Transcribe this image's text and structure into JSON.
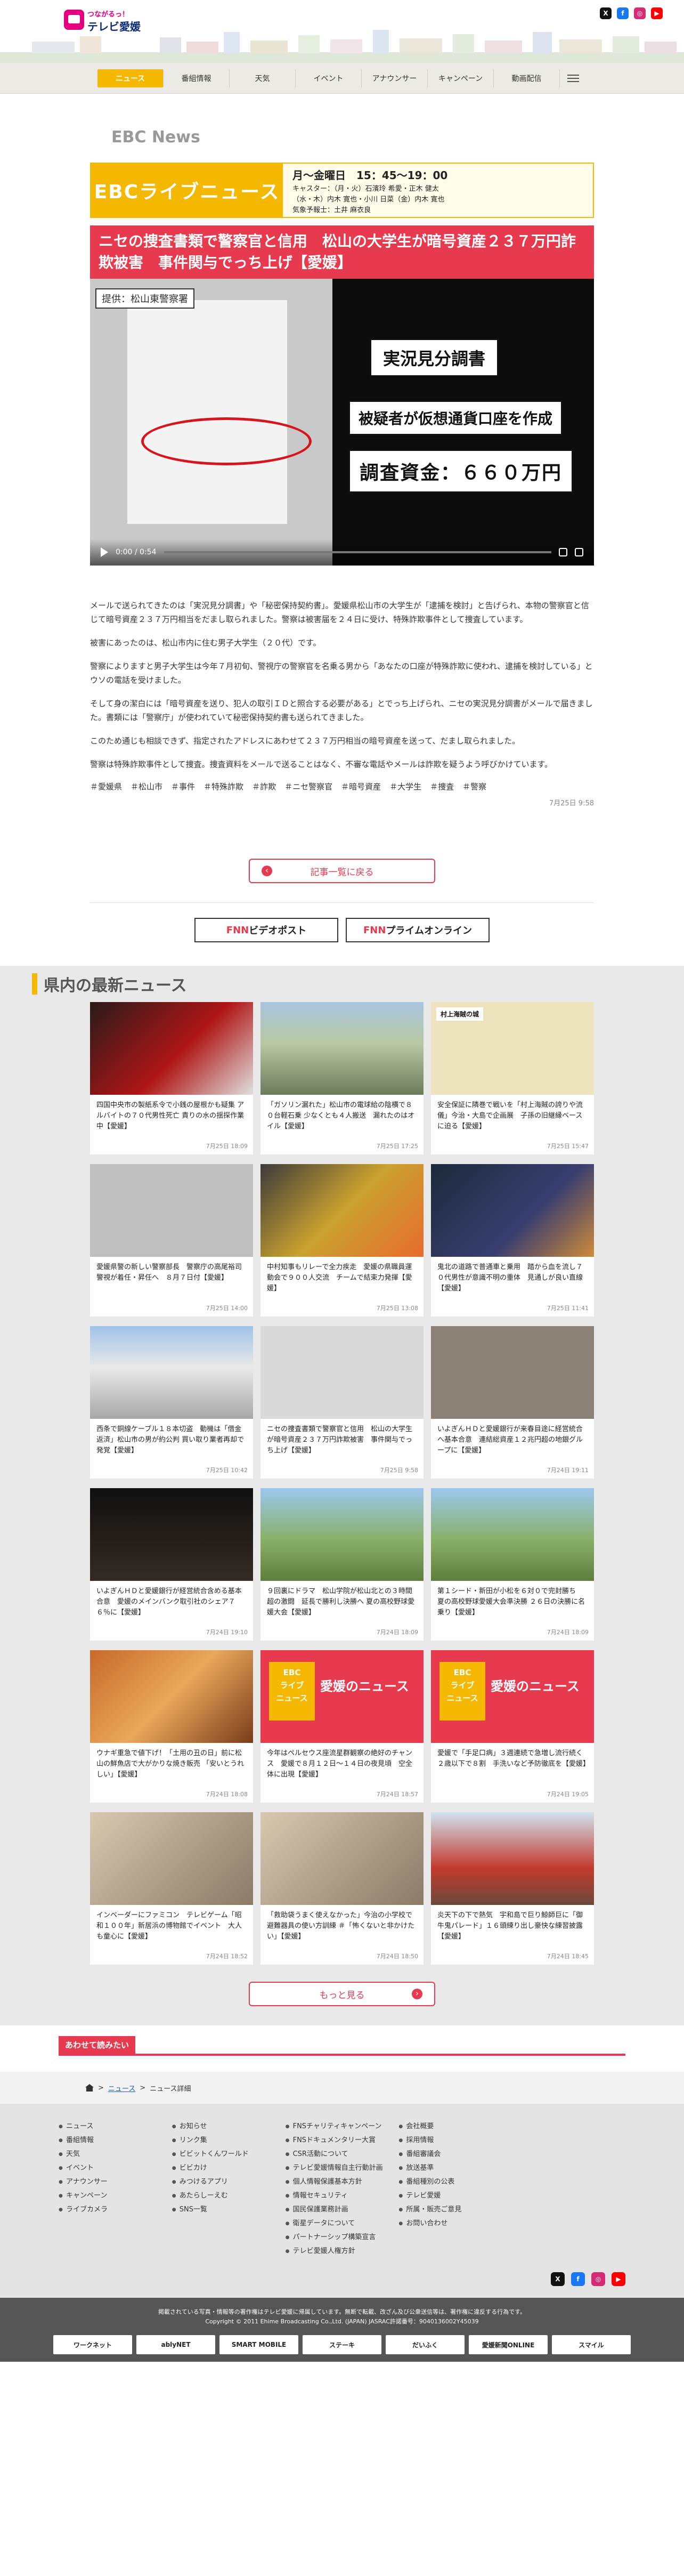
{
  "header": {
    "logo_top": "つながるっ！",
    "logo_main": "テレビ愛媛",
    "social": [
      {
        "name": "x-icon",
        "glyph": "X",
        "color": "#111111"
      },
      {
        "name": "facebook-icon",
        "glyph": "f",
        "color": "#1877f2"
      },
      {
        "name": "instagram-icon",
        "glyph": "◎",
        "color": "#d62976"
      },
      {
        "name": "youtube-icon",
        "glyph": "▶",
        "color": "#ff0000"
      }
    ]
  },
  "nav": {
    "items": [
      "ニュース",
      "番組情報",
      "天気",
      "イベント",
      "アナウンサー",
      "キャンペーン",
      "動画配信"
    ]
  },
  "section_title": "EBC News",
  "banner": {
    "title": "EBCライブニュース",
    "time": "月～金曜日　15：45～19：00",
    "cast1": "キャスター：（月・火）石濱玲 希愛・正木 健太",
    "cast2": "（水・木）内木 寛也・小川 日菜（金）内木 寛也",
    "cast3": "気象予報士：土井 麻衣良"
  },
  "article": {
    "headline": "ニセの捜査書類で警察官と信用　松山の大学生が暗号資産２３７万円詐欺被害　事件関与でっち上げ【愛媛】",
    "video": {
      "doc_tag": "提供：松山東警察署",
      "cap1": "実況見分調書",
      "cap2": "被疑者が仮想通貨口座を作成",
      "cap3": "調査資金：６６０万円",
      "time": "0:00 / 0:54"
    },
    "paragraphs": [
      "メールで送られてきたのは「実況見分調書」や「秘密保持契約書」。愛媛県松山市の大学生が「逮捕を検討」と告げられ、本物の警察官と信じて暗号資産２３７万円相当をだまし取られました。警察は被害届を２４日に受け、特殊詐欺事件として捜査しています。",
      "被害にあったのは、松山市内に住む男子大学生（２０代）です。",
      "警察によりますと男子大学生は今年７月初旬、警視庁の警察官を名乗る男から「あなたの口座が特殊詐欺に使われ、逮捕を検討している」とウソの電話を受けました。",
      "そして身の潔白には「暗号資産を送り、犯人の取引ＩＤと照合する必要がある」とでっち上げられ、ニセの実況見分調書がメールで届きました。書類には「警察庁」が使われていて秘密保持契約書も送られてきました。",
      "このため通じも相談できず、指定されたアドレスにあわせて２３７万円相当の暗号資産を送って、だまし取られました。",
      "警察は特殊詐欺事件として捜査。捜査資料をメールで送ることはなく、不審な電話やメールは詐欺を疑うよう呼びかけています。"
    ],
    "tags": [
      "＃愛媛県",
      "＃松山市",
      "＃事件",
      "＃特殊詐欺",
      "＃詐欺",
      "＃ニセ警察官",
      "＃暗号資産",
      "＃大学生",
      "＃捜査",
      "＃警察"
    ],
    "date": "7月25日 9:58"
  },
  "back_label": "記事一覧に戻る",
  "partners": [
    {
      "a": "FNN",
      "b": "ビデオポスト"
    },
    {
      "a": "FNN",
      "b": "プライムオンライン"
    }
  ],
  "news_heading": "県内の最新ニュース",
  "news": [
    {
      "thumb": "t-red",
      "title": "四国中央市の製紙系令で小銭の屋根かも疑集 アルバイトの７０代男性死亡 責りの水の揺探作業中【愛媛】",
      "date": "7月25日 18:09"
    },
    {
      "thumb": "t-town",
      "title": "「ガソリン漏れた」松山市の電球給の陰横で８０台軽石乗 少なくとも４人搬送　漏れたのはオイル【愛媛】",
      "date": "7月25日 17:25"
    },
    {
      "thumb": "t-doc",
      "overlay": "村上海賊の城",
      "title": "安全保証に隣巻で戦いを「村上海賊の誇りや流儀」今治・大島で企画展　子孫の旧継縁ベースに迫る【愛媛】",
      "date": "7月25日 15:47"
    },
    {
      "thumb": "t-man",
      "title": "愛媛県警の新しい警察部長　警察庁の高尾裕司警視が着任・昇任へ　８月７日付【愛媛】",
      "date": "7月25日 14:00"
    },
    {
      "thumb": "t-crowd",
      "title": "中村知事もリレーで全力疾走　愛媛の県職員運動会で９００人交流　チームで結束力発揮【愛媛】",
      "date": "7月25日 13:08"
    },
    {
      "thumb": "t-dark",
      "title": "鬼北の道路で普通車と乗用　踏から血を流し７０代男性が意識不明の重体　見通しが良い直線【愛媛】",
      "date": "7月25日 11:41"
    },
    {
      "thumb": "t-school",
      "title": "西条で銅線ケーブル１８本切盗　動機は「借金返済」松山市の男が約公判 買い取り業者再却で発覚【愛媛】",
      "date": "7月25日 10:42"
    },
    {
      "thumb": "t-paper",
      "title": "ニセの捜査書類で警察官と信用　松山の大学生が暗号資産２３７万円詐欺被害　事件関与でっち上げ【愛媛】",
      "date": "7月25日 9:58"
    },
    {
      "thumb": "t-sign",
      "title": "いよぎんＨＤと愛媛銀行が来春目途に経営統合へ基本合意　連結総資産１２兆円超の地銀グループに【愛媛】",
      "date": "7月24日 19:11"
    },
    {
      "thumb": "t-nite",
      "title": "いよぎんＨＤと愛媛銀行が経営統合含める基本合意　愛媛のメインバンク取引社のシェア７６％に【愛媛】",
      "date": "7月24日 19:10"
    },
    {
      "thumb": "t-stad",
      "title": "９回裏にドラマ　松山学院が松山北との３時間超の激闘　延長で勝利し決勝へ 夏の高校野球愛媛大会【愛媛】",
      "date": "7月24日 18:09"
    },
    {
      "thumb": "t-stad",
      "title": "第１シード・新田が小松を６対０で完封勝ち　夏の高校野球愛媛大会準決勝 ２６日の決勝に名乗り【愛媛】",
      "date": "7月24日 18:09"
    },
    {
      "thumb": "t-food",
      "title": "ウナギ重急で値下げ！「土用の丑の日」前に松山の鮮魚店で大がかりな焼き販売 「安いとうれしい」【愛媛】",
      "date": "7月24日 18:08"
    },
    {
      "thumb": "t-ebc",
      "ebc": "愛媛のニュース",
      "title": "今年はペルセウス座流星群観察の絶好のチャンス　愛媛で８月１２日～１４日の夜見頃　空全体に出現【愛媛】",
      "date": "7月24日 18:57"
    },
    {
      "thumb": "t-ebc",
      "ebc": "愛媛のニュース",
      "title": "愛媛で「手足口病」３週連続で急増し流行続く　２歳以下で８割　手洗いなど予防徹底を【愛媛】",
      "date": "7月24日 19:05"
    },
    {
      "thumb": "t-room",
      "title": "インベーダーにファミコン　テレビゲーム「昭和１００年」新居浜の博物館でイベント　大人も童心に【愛媛】",
      "date": "7月24日 18:52"
    },
    {
      "thumb": "t-room",
      "title": "「救助袋うまく使えなかった」今治の小学校で避難器具の使い方訓練 ＃「怖くないと非かけたい」【愛媛】",
      "date": "7月24日 18:50"
    },
    {
      "thumb": "t-fish",
      "title": "炎天下の下で熱気　宇和島で巨り鯨師巨に「御牛鬼パレード」１６頭練り出し豪快な練習披露【愛媛】",
      "date": "7月24日 18:45"
    }
  ],
  "more_label": "もっと見る",
  "also_label": "あわせて読みたい",
  "breadcrumb": [
    "ニュース",
    "ニュース詳細"
  ],
  "footer": {
    "cols": [
      [
        "ニュース",
        "番組情報",
        "天気",
        "イベント",
        "アナウンサー",
        "キャンペーン",
        "ライブカメラ"
      ],
      [
        "お知らせ",
        "リンク集",
        "ビビットくんワールド",
        "ビビカけ",
        "みつけるアプリ",
        "あたらしーえむ",
        "SNS一覧"
      ],
      [
        "FNSチャリティキャンペーン",
        "FNSドキュメンタリー大賞",
        "CSR活動について",
        "テレビ愛媛情報自主行動計画",
        "個人情報保護基本方針",
        "情報セキュリティ",
        "国民保護業務計画",
        "衛星データについて",
        "パートナーシップ構築宣言",
        "テレビ愛媛人権方針"
      ],
      [
        "会社概要",
        "採用情報",
        "番組審議会",
        "放送基準",
        "番組種別の公表",
        "テレビ愛媛",
        "所属・販売ご意見",
        "お問い合わせ"
      ]
    ],
    "copy1": "掲載されている写真・情報等の著作権はテレビ愛媛に帰属しています。無断で転載、改ざん及び公衆送信等は、著作権に違反する行為です。",
    "copy2": "Copyright © 2011 Ehime Broadcasting Co.,Ltd. (JAPAN)  JASRAC許諾番号：9040136002Y45039",
    "banners": [
      "ワークネット",
      "ablyNET",
      "SMART MOBILE",
      "ステーキ",
      "だいふく",
      "愛媛新聞ONLINE",
      "スマイル"
    ]
  }
}
